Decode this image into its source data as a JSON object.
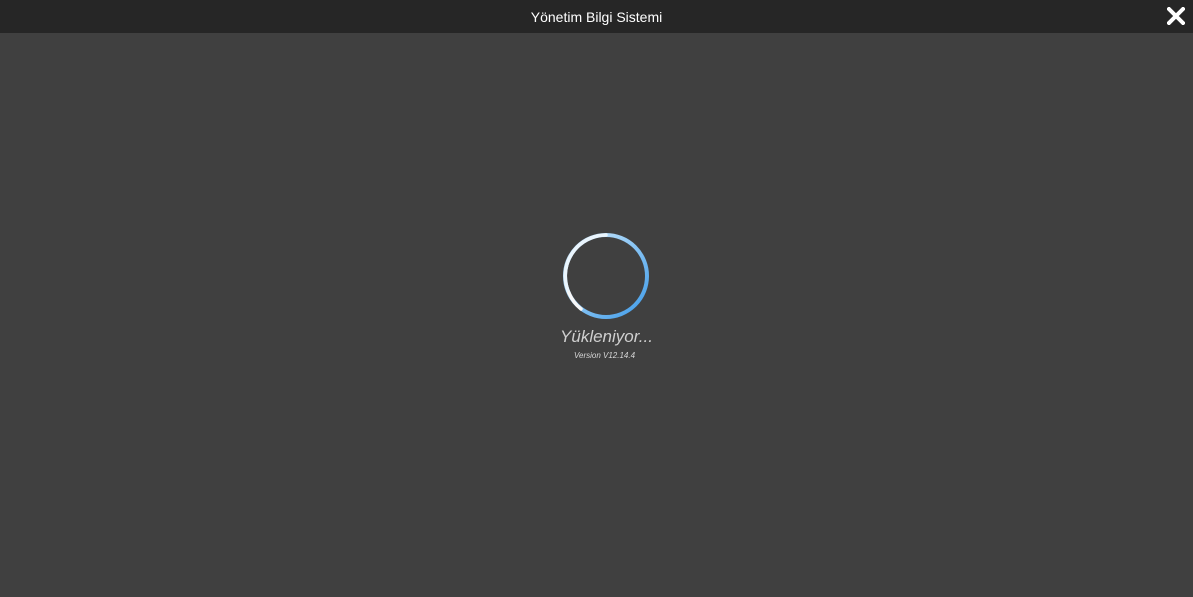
{
  "window": {
    "title": "Yönetim Bilgi Sistemi",
    "close_icon": "close-icon"
  },
  "loader": {
    "status_text": "Yükleniyor...",
    "version_text": "Version V12.14.4",
    "spinner_icon": "loading-spinner-icon"
  },
  "colors": {
    "background": "#404040",
    "titlebar": "#262626",
    "spinner_accent": "#3d9ae8",
    "spinner_light": "#c7e3fa"
  }
}
